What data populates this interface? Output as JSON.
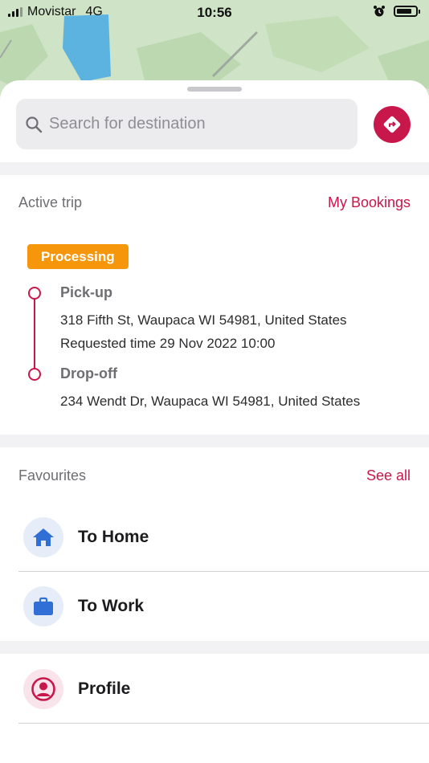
{
  "status_bar": {
    "carrier": "Movistar",
    "network": "4G",
    "time": "10:56"
  },
  "search": {
    "placeholder": "Search for destination"
  },
  "active_trip": {
    "title": "Active trip",
    "bookings_link": "My Bookings",
    "status_badge": "Processing",
    "pickup": {
      "label": "Pick-up",
      "address": "318 Fifth St, Waupaca WI 54981, United States",
      "requested_time": "Requested time 29 Nov 2022 10:00"
    },
    "dropoff": {
      "label": "Drop-off",
      "address": "234 Wendt Dr, Waupaca WI 54981, United States"
    }
  },
  "favourites": {
    "title": "Favourites",
    "see_all": "See all",
    "items": [
      {
        "label": "To Home",
        "icon": "home-icon"
      },
      {
        "label": "To Work",
        "icon": "briefcase-icon"
      }
    ]
  },
  "profile": {
    "label": "Profile",
    "icon": "user-circle-icon"
  },
  "colors": {
    "accent": "#c8174a",
    "badge": "#f5960b",
    "fav_icon_bg": "#e6ecf8",
    "fav_icon_fg": "#2f6fd6",
    "profile_bg": "#f8e4ea"
  }
}
